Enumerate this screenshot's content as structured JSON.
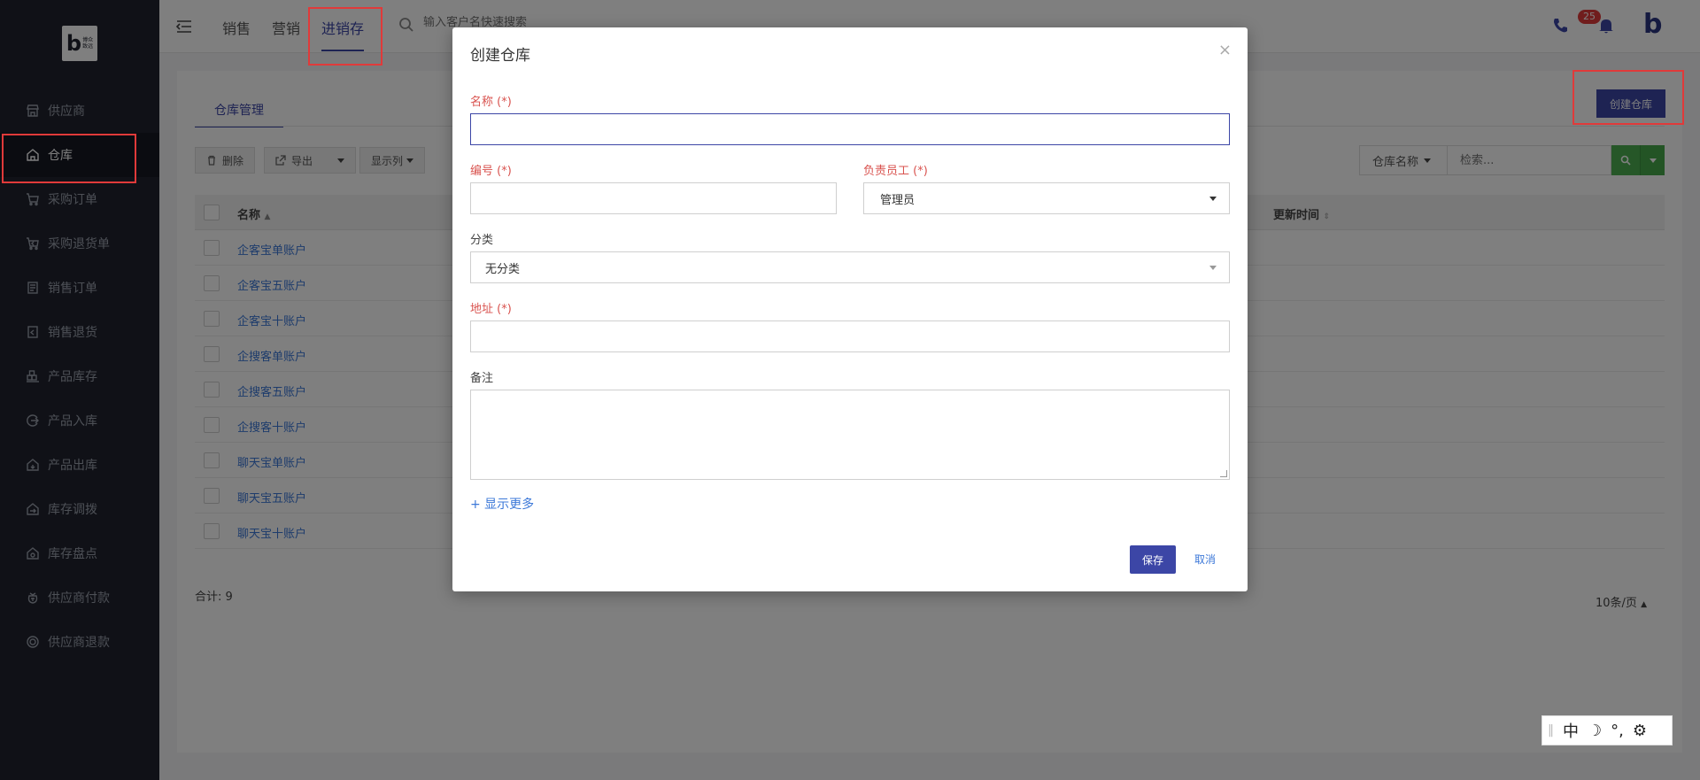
{
  "logo": {
    "mark": "b",
    "text_line1": "博众",
    "text_line2": "致远"
  },
  "sidebar": {
    "items": [
      {
        "label": "供应商",
        "icon": "store-icon"
      },
      {
        "label": "仓库",
        "icon": "warehouse-icon"
      },
      {
        "label": "采购订单",
        "icon": "cart-icon"
      },
      {
        "label": "采购退货单",
        "icon": "cart-return-icon"
      },
      {
        "label": "销售订单",
        "icon": "order-icon"
      },
      {
        "label": "销售退货",
        "icon": "sales-return-icon"
      },
      {
        "label": "产品库存",
        "icon": "stock-icon"
      },
      {
        "label": "产品入库",
        "icon": "inbound-icon"
      },
      {
        "label": "产品出库",
        "icon": "outbound-icon"
      },
      {
        "label": "库存调拨",
        "icon": "transfer-icon"
      },
      {
        "label": "库存盘点",
        "icon": "inventory-check-icon"
      },
      {
        "label": "供应商付款",
        "icon": "payment-icon"
      },
      {
        "label": "供应商退款",
        "icon": "refund-icon"
      }
    ],
    "active_index": 1
  },
  "header": {
    "tabs": [
      "销售",
      "营销",
      "进销存"
    ],
    "active_tab": "进销存",
    "search_placeholder": "输入客户名快速搜索",
    "notification_count": "25",
    "brand_mark": "b"
  },
  "content": {
    "tab": "仓库管理",
    "create_button": "创建仓库",
    "toolbar": {
      "delete": "删除",
      "export": "导出",
      "columns": "显示列"
    },
    "filter": {
      "field": "仓库名称",
      "placeholder": "检索..."
    },
    "table": {
      "headers": {
        "name": "名称",
        "updated": "更新时间"
      },
      "rows": [
        "企客宝单账户",
        "企客宝五账户",
        "企客宝十账户",
        "企搜客单账户",
        "企搜客五账户",
        "企搜客十账户",
        "聊天宝单账户",
        "聊天宝五账户",
        "聊天宝十账户"
      ]
    },
    "total": "合计: 9",
    "page_size": "10条/页"
  },
  "modal": {
    "title": "创建仓库",
    "name_label": "名称 (*)",
    "code_label": "编号 (*)",
    "owner_label": "负责员工 (*)",
    "owner_value": "管理员",
    "category_label": "分类",
    "category_value": "无分类",
    "address_label": "地址 (*)",
    "note_label": "备注",
    "show_more": "+ 显示更多",
    "save": "保存",
    "cancel": "取消"
  },
  "ime": {
    "lang": "中",
    "punct": "°,"
  },
  "colors": {
    "primary": "#3c46a6",
    "sidebar": "#20232e",
    "required": "#d9534f",
    "link": "#3c78d8",
    "highlight": "#e03a3a",
    "search_green": "#4caf50"
  }
}
